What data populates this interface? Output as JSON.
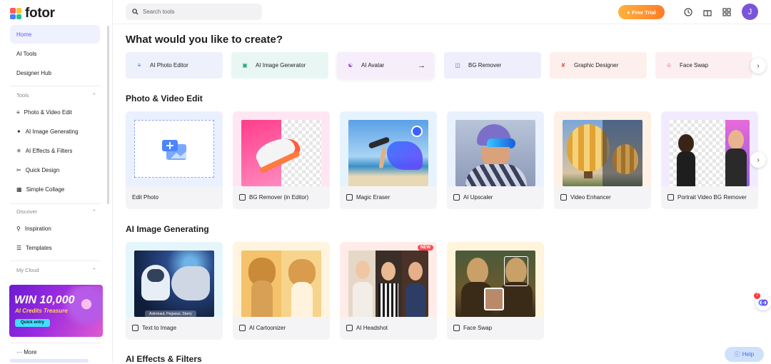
{
  "brand": {
    "name": "fotor"
  },
  "sidebar": {
    "nav": [
      {
        "label": "Home"
      },
      {
        "label": "AI Tools"
      },
      {
        "label": "Designer Hub"
      }
    ],
    "tools_header": "Tools",
    "tools": [
      {
        "label": "Photo & Video Edit",
        "icon": "sliders-icon"
      },
      {
        "label": "AI Image Generating",
        "icon": "magic-wand-icon"
      },
      {
        "label": "AI Effects & Filters",
        "icon": "sparkle-icon"
      },
      {
        "label": "Quick Design",
        "icon": "scissors-icon"
      },
      {
        "label": "Simple Collage",
        "icon": "collage-icon"
      }
    ],
    "discover_header": "Discover",
    "discover": [
      {
        "label": "Inspiration",
        "icon": "lightbulb-icon"
      },
      {
        "label": "Templates",
        "icon": "layers-icon"
      }
    ],
    "cloud_header": "My Cloud",
    "promo": {
      "title": "WIN 10,000",
      "subtitle": "AI Credits Treasure",
      "button": "Quick entry"
    },
    "more_label": "More"
  },
  "topbar": {
    "search_placeholder": "Search tools",
    "trial_label": "Free Trial",
    "avatar_initial": "J"
  },
  "main": {
    "heading": "What would you like to create?",
    "quick_tiles": [
      {
        "label": "AI Photo Editor",
        "bg": "#eef1fb",
        "color": "#3f6fd8"
      },
      {
        "label": "AI Image Generator",
        "bg": "#e8f7f3",
        "color": "#22a37f"
      },
      {
        "label": "AI Avatar",
        "bg": "#f6eefb",
        "color": "#9b42d8"
      },
      {
        "label": "BG Remover",
        "bg": "#efeefc",
        "color": "#6b5ad8"
      },
      {
        "label": "Graphic Designer",
        "bg": "#fdf0ec",
        "color": "#e2574c"
      },
      {
        "label": "Face Swap",
        "bg": "#fdeef2",
        "color": "#e0407a"
      }
    ],
    "sections": [
      {
        "title": "Photo & Video Edit",
        "cards": [
          {
            "label": "Edit Photo"
          },
          {
            "label": "BG Remover (in Editor)"
          },
          {
            "label": "Magic Eraser"
          },
          {
            "label": "AI Upscaler"
          },
          {
            "label": "Video Enhancer"
          },
          {
            "label": "Portrait Video BG Remover"
          }
        ]
      },
      {
        "title": "AI Image Generating",
        "cards": [
          {
            "label": "Text to Image",
            "caption": "Astronaut, Pegasus, Starry"
          },
          {
            "label": "AI Cartoonizer"
          },
          {
            "label": "AI Headshot",
            "badge": "NEW"
          },
          {
            "label": "Face Swap"
          }
        ]
      },
      {
        "title": "AI Effects & Filters"
      }
    ]
  },
  "help_label": "Help",
  "notification_count": "7"
}
